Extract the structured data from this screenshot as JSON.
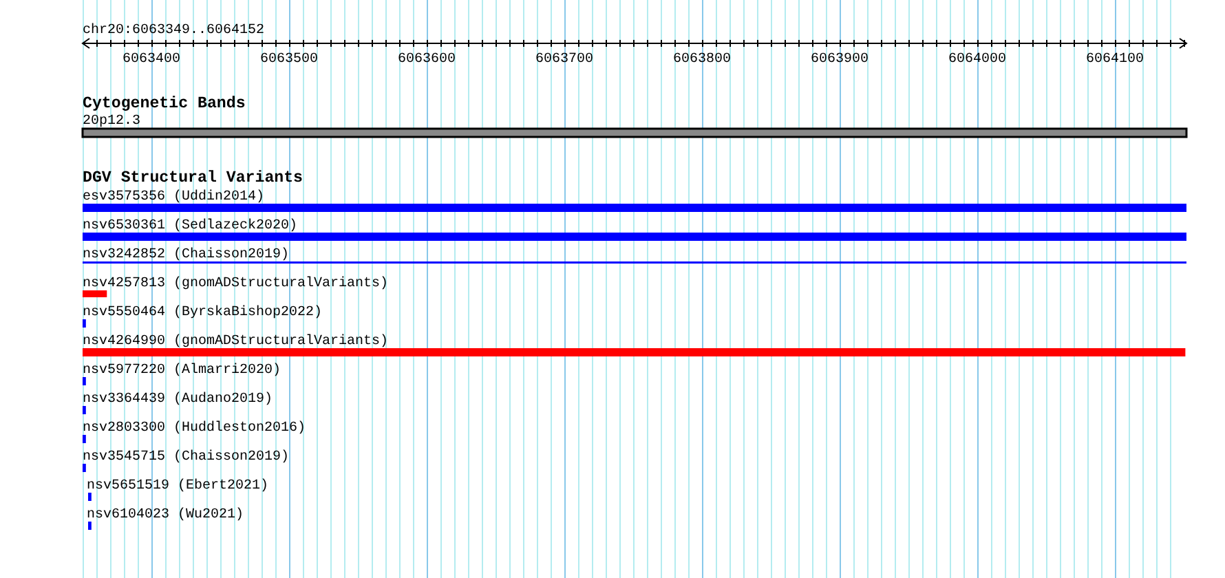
{
  "ruler": {
    "location": "chr20:6063349..6064152",
    "tick_labels": [
      "6063400",
      "6063500",
      "6063600",
      "6063700",
      "6063800",
      "6063900",
      "6064000",
      "6064100"
    ]
  },
  "tracks": [
    {
      "kind": "bands",
      "title": "Cytogenetic Bands",
      "features": [
        {
          "label": "20p12.3"
        }
      ]
    },
    {
      "kind": "variants",
      "title": "DGV Structural Variants",
      "features": [
        {
          "label": "esv3575356 (Uddin2014)",
          "color": "#0000ff"
        },
        {
          "label": "nsv6530361 (Sedlazeck2020)",
          "color": "#0000ff"
        },
        {
          "label": "nsv3242852 (Chaisson2019)",
          "color": "#0000ff"
        },
        {
          "label": "nsv4257813 (gnomADStructuralVariants)",
          "color": "#ff0000"
        },
        {
          "label": "nsv5550464 (ByrskaBishop2022)",
          "color": "#0000ff"
        },
        {
          "label": "nsv4264990 (gnomADStructuralVariants)",
          "color": "#ff0000"
        },
        {
          "label": "nsv5977220 (Almarri2020)",
          "color": "#0000ff"
        },
        {
          "label": "nsv3364439 (Audano2019)",
          "color": "#0000ff"
        },
        {
          "label": "nsv2803300 (Huddleston2016)",
          "color": "#0000ff"
        },
        {
          "label": "nsv3545715 (Chaisson2019)",
          "color": "#0000ff"
        },
        {
          "label": "nsv5651519 (Ebert2021)",
          "color": "#0000ff"
        },
        {
          "label": "nsv6104023 (Wu2021)",
          "color": "#0000ff"
        }
      ]
    }
  ]
}
